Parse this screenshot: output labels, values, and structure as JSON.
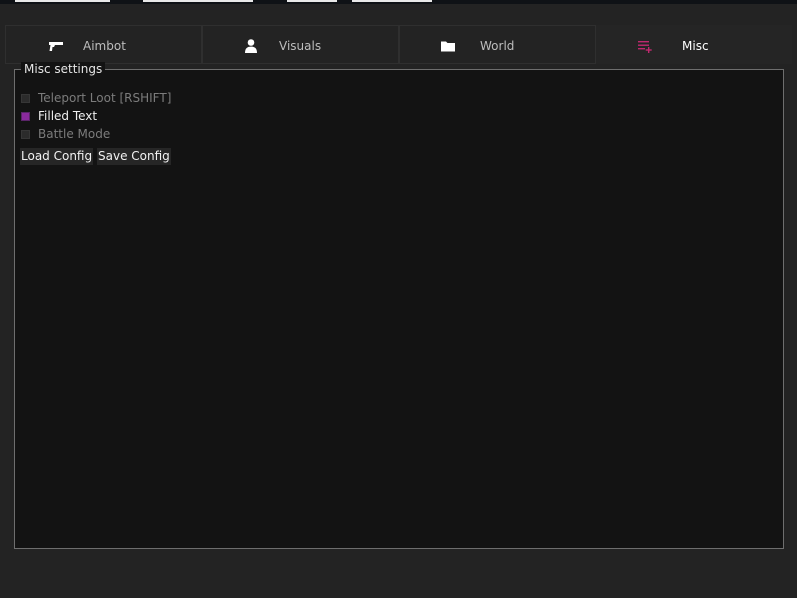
{
  "tabs": [
    {
      "label": "Aimbot",
      "icon": "gun-icon",
      "active": false
    },
    {
      "label": "Visuals",
      "icon": "user-icon",
      "active": false
    },
    {
      "label": "World",
      "icon": "folder-icon",
      "active": false
    },
    {
      "label": "Misc",
      "icon": "list-add-icon",
      "active": true
    }
  ],
  "misc": {
    "group_title": "Misc settings",
    "options": [
      {
        "label": "Teleport Loot [RSHIFT]",
        "checked": false
      },
      {
        "label": "Filled Text",
        "checked": true
      },
      {
        "label": "Battle Mode",
        "checked": false
      }
    ],
    "load_label": "Load Config",
    "save_label": "Save Config"
  },
  "colors": {
    "accent": "#8a2a9c",
    "active_icon": "#c0286e",
    "background": "#232323",
    "panel": "#131313"
  }
}
